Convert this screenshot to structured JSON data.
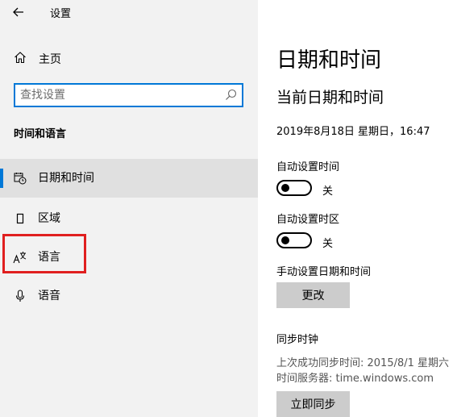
{
  "window": {
    "title": "设置"
  },
  "sidebar": {
    "home_label": "主页",
    "search_placeholder": "查找设置",
    "section_header": "时间和语言",
    "items": [
      {
        "label": "日期和时间",
        "icon": "calendar-clock-icon",
        "active": true
      },
      {
        "label": "区域",
        "icon": "region-icon",
        "active": false
      },
      {
        "label": "语言",
        "icon": "language-icon",
        "active": false
      },
      {
        "label": "语音",
        "icon": "microphone-icon",
        "active": false
      }
    ]
  },
  "main": {
    "title": "日期和时间",
    "current_header": "当前日期和时间",
    "current_datetime": "2019年8月18日 星期日，16:47",
    "auto_time": {
      "label": "自动设置时间",
      "state": "关"
    },
    "auto_timezone": {
      "label": "自动设置时区",
      "state": "关"
    },
    "manual": {
      "label": "手动设置日期和时间",
      "button": "更改"
    },
    "sync": {
      "header": "同步时钟",
      "last_sync": "上次成功同步时间: 2015/8/1 星期六",
      "server": "时间服务器: time.windows.com",
      "button": "立即同步"
    }
  },
  "colors": {
    "accent": "#0078d7",
    "highlight": "#e01f1f",
    "sidebar_bg": "#f2f2f2"
  }
}
